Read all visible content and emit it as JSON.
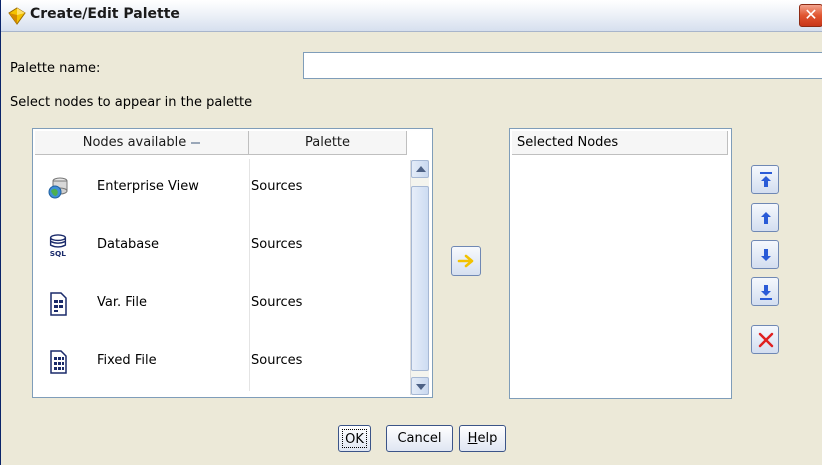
{
  "window": {
    "title": "Create/Edit Palette",
    "close_glyph": "✕"
  },
  "palette_name": {
    "label": "Palette name:",
    "value": ""
  },
  "select_label": "Select nodes to appear in the palette",
  "nodes_table": {
    "headers": {
      "nodes": "Nodes available",
      "palette": "Palette"
    },
    "rows": [
      {
        "name": "Enterprise View",
        "palette": "Sources",
        "icon": "enterprise-view-icon"
      },
      {
        "name": "Database",
        "palette": "Sources",
        "icon": "database-sql-icon"
      },
      {
        "name": "Var. File",
        "palette": "Sources",
        "icon": "var-file-icon"
      },
      {
        "name": "Fixed File",
        "palette": "Sources",
        "icon": "fixed-file-icon"
      }
    ]
  },
  "selected_nodes": {
    "header": "Selected Nodes",
    "items": []
  },
  "buttons": {
    "ok": "OK",
    "cancel": "Cancel",
    "help_prefix": "H",
    "help_rest": "elp"
  },
  "colors": {
    "accent_arrow": "#f2c200",
    "order_arrow": "#2a5bd7",
    "remove_x": "#e02020"
  }
}
